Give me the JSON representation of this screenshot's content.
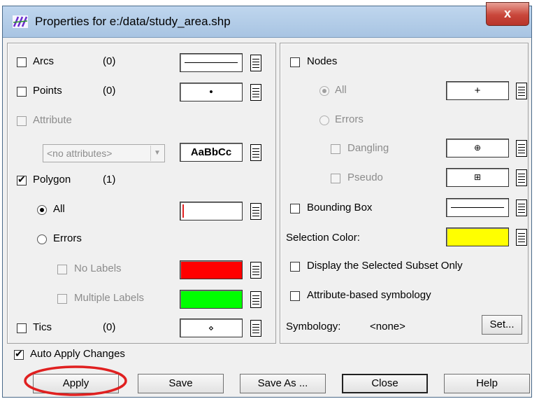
{
  "window": {
    "title": "Properties for e:/data/study_area.shp",
    "close_label": "x",
    "app_icon": "app-logo-icon"
  },
  "left": {
    "arcs": {
      "label": "Arcs",
      "count": "(0)",
      "checked": false
    },
    "points": {
      "label": "Points",
      "count": "(0)",
      "checked": false,
      "symbol": "•"
    },
    "attribute": {
      "label": "Attribute",
      "checked": false,
      "disabled": true
    },
    "attribute_select": {
      "value": "<no attributes>"
    },
    "font_sample": "AaBbCc",
    "polygon": {
      "label": "Polygon",
      "count": "(1)",
      "checked": true
    },
    "poly_all": {
      "label": "All",
      "selected": true
    },
    "poly_errors": {
      "label": "Errors",
      "selected": false
    },
    "no_labels": {
      "label": "No Labels",
      "color": "#ff0000"
    },
    "multiple_labels": {
      "label": "Multiple Labels",
      "color": "#00ff00"
    },
    "tics": {
      "label": "Tics",
      "count": "(0)",
      "checked": false,
      "symbol": "⋄"
    }
  },
  "right": {
    "nodes": {
      "label": "Nodes",
      "checked": false
    },
    "nodes_all": {
      "label": "All",
      "selected": true,
      "symbol": "+"
    },
    "nodes_errors": {
      "label": "Errors",
      "selected": false
    },
    "dangling": {
      "label": "Dangling",
      "symbol": "⊕"
    },
    "pseudo": {
      "label": "Pseudo",
      "symbol": "⊞"
    },
    "bounding_box": {
      "label": "Bounding Box",
      "checked": false
    },
    "selection_color": {
      "label": "Selection Color:",
      "color": "#ffff00"
    },
    "display_subset": {
      "label": "Display the Selected Subset Only"
    },
    "attr_symbology": {
      "label": "Attribute-based symbology"
    },
    "symbology": {
      "label": "Symbology:",
      "value": "<none>",
      "button": "Set..."
    }
  },
  "auto_apply": {
    "label": "Auto Apply Changes",
    "checked": true
  },
  "buttons": {
    "apply": "Apply",
    "save": "Save",
    "save_as": "Save As ...",
    "close": "Close",
    "help": "Help"
  },
  "annotation_color": "#e02020"
}
